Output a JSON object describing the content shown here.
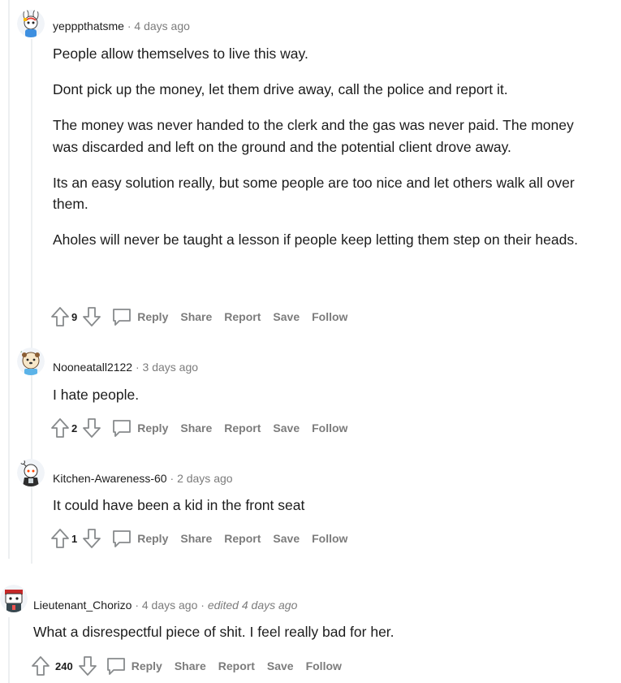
{
  "comments": [
    {
      "user": "yepppthatsme",
      "time": "4 days ago",
      "paragraphs": [
        "People allow themselves to live this way.",
        "Dont pick up the money, let them drive away, call the police and report it.",
        "The money was never handed to the clerk and the gas was never paid. The money was discarded and left on the ground and the potential client drove away.",
        "Its an easy solution really, but some people are too nice and let others walk all over them.",
        "Aholes will never be taught a lesson if people keep letting them step on their heads."
      ],
      "score": "9"
    },
    {
      "user": "Nooneatall2122",
      "time": "3 days ago",
      "paragraphs": [
        "I hate people."
      ],
      "score": "2"
    },
    {
      "user": "Kitchen-Awareness-60",
      "time": "2 days ago",
      "paragraphs": [
        "It could have been a kid in the front seat"
      ],
      "score": "1"
    },
    {
      "user": "Lieutenant_Chorizo",
      "time": "4 days ago",
      "edited": "edited 4 days ago",
      "paragraphs": [
        "What a disrespectful piece of shit. I feel really bad for her."
      ],
      "score": "240"
    }
  ],
  "actions": {
    "reply": "Reply",
    "share": "Share",
    "report": "Report",
    "save": "Save",
    "follow": "Follow"
  },
  "separator": "·",
  "icons": {
    "upvote": "upvote-arrow-icon",
    "downvote": "downvote-arrow-icon",
    "reply": "speech-bubble-icon"
  },
  "colors": {
    "text": "#1c1c1c",
    "meta": "#7c7c7c",
    "thread_line": "#edeff1"
  }
}
